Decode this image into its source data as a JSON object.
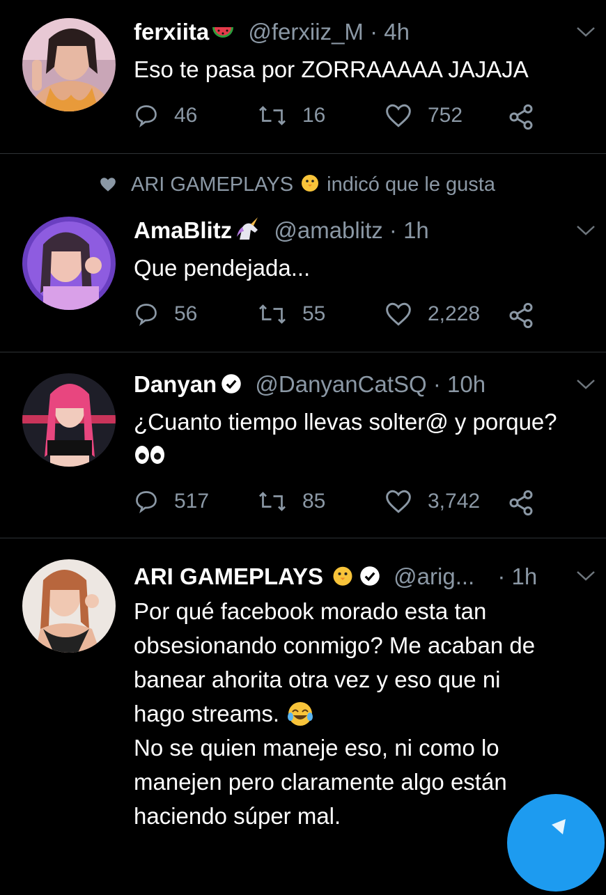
{
  "tweets": [
    {
      "name": "ferxiita",
      "name_emoji": "watermelon",
      "handle": "@ferxiiz_M",
      "time": "· 4h",
      "lines": [
        "Eso te pasa por ZORRAAAAA JAJAJA"
      ],
      "replies": "46",
      "retweets": "16",
      "likes": "752"
    },
    {
      "liked_by": "ARI GAMEPLAYS",
      "liked_by_suffix": "indicó que le gusta",
      "name": "AmaBlitz",
      "name_emoji": "unicorn",
      "handle": "@amablitz",
      "time": "· 1h",
      "lines": [
        "Que pendejada..."
      ],
      "replies": "56",
      "retweets": "55",
      "likes": "2,228"
    },
    {
      "name": "Danyan",
      "handle": "@DanyanCatSQ",
      "time": "· 10h",
      "lines": [
        "¿Cuanto tiempo llevas solter@ y porque?"
      ],
      "replies": "517",
      "retweets": "85",
      "likes": "3,742"
    },
    {
      "name": "ARI GAMEPLAYS",
      "name_emoji": "chick",
      "handle": "@arig...",
      "time": "· 1h",
      "lines": [
        "Por qué facebook morado esta tan",
        "obsesionando conmigo? Me acaban de",
        "banear ahorita otra vez y eso que ni",
        "hago streams.",
        "No se quien maneje eso, ni como lo",
        "manejen pero claramente algo están",
        "haciendo súper mal."
      ]
    }
  ],
  "colors": {
    "background": "#000000",
    "secondary_text": "#8b98a5",
    "accent": "#1d9bf0"
  }
}
